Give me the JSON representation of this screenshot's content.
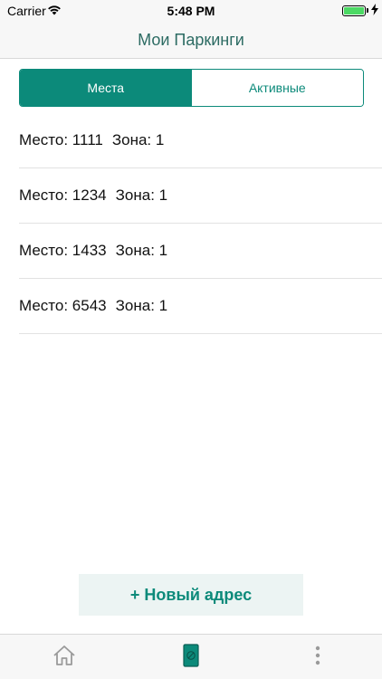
{
  "status_bar": {
    "carrier": "Carrier",
    "time": "5:48 PM",
    "battery_level": 1.0,
    "charging": true
  },
  "header": {
    "title": "Мои Паркинги"
  },
  "segmented_control": {
    "segments": [
      {
        "label": "Места",
        "selected": true
      },
      {
        "label": "Активные",
        "selected": false
      }
    ]
  },
  "parking_list": {
    "items": [
      {
        "place": "Место: 1111",
        "zone": "Зона: 1"
      },
      {
        "place": "Место: 1234",
        "zone": "Зона: 1"
      },
      {
        "place": "Место: 1433",
        "zone": "Зона: 1"
      },
      {
        "place": "Место: 6543",
        "zone": "Зона: 1"
      }
    ]
  },
  "new_address_button": {
    "label": "+ Новый адрес"
  },
  "tab_bar": {
    "tabs": [
      {
        "icon": "home-icon",
        "selected": false
      },
      {
        "icon": "parking-icon",
        "selected": true
      },
      {
        "icon": "more-icon",
        "selected": false
      }
    ]
  },
  "colors": {
    "accent": "#0c8a7a",
    "title": "#2c6b63",
    "button_bg": "#ecf4f3",
    "battery": "#4cd964"
  }
}
